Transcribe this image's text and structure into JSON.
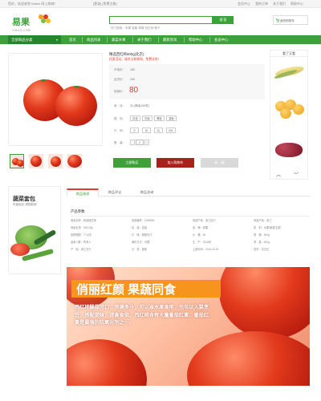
{
  "topbar": {
    "greeting": "您好，欢迎来到 Watch 网上商城！",
    "login_register": "[登录] [免费注册]",
    "links": [
      "会员中心",
      "我的订单",
      "关于我们",
      "帮助中心"
    ]
  },
  "header": {
    "logo_text": "易果",
    "logo_sub": "YIGUO.COM",
    "search_placeholder": "",
    "search_button": "搜 索",
    "hot_keywords": "热门搜索：苹果  香蕉  草莓  西红柿  橙子",
    "cart_label": "我的购物车"
  },
  "nav": {
    "all_categories": "全部商品分类",
    "items": [
      "首页",
      "商品列表",
      "蔬菜水果",
      "关于我们",
      "最新资讯",
      "帮助中心",
      "会员中心"
    ]
  },
  "product": {
    "title": "精选西红柿600g(北京)",
    "promo": "优惠活动，请关注易果网，免费试吃！",
    "market_price_label": "市场价：",
    "market_price": "150",
    "member_price_label": "会员价：",
    "member_price": "100",
    "sale_price_label": "促销价：",
    "sale_price": "80",
    "stock_label": "库　存：",
    "stock_value": "31 (剩余299件)",
    "color_label": "颜　色：",
    "colors": [
      "红色",
      "白色",
      "黑色",
      "蓝色"
    ],
    "size_label": "尺　码：",
    "sizes": [
      "S",
      "M",
      "XL",
      "XXL"
    ],
    "qty_label": "数　量：",
    "qty_value": "2",
    "buy_now": "立即购买",
    "add_to_cart": "加入购物车",
    "favorite": "收　藏"
  },
  "side": {
    "title": "看了又看"
  },
  "promo_card": {
    "title": "蔬菜套包",
    "subtitle": "时蔬组合 搭配新鲜"
  },
  "tabs": [
    "商品描述",
    "商品评论",
    "商品咨询"
  ],
  "params": {
    "title": "产品参数",
    "rows": [
      [
        "商品名称：精选西红柿",
        "商品编号：1049966",
        "商品产地：浙江嘉兴",
        "商品产地：浙江"
      ],
      [
        "商品毛重：500.00g",
        "包　装：盒装",
        "品　牌：易果",
        "类　别：水果/蔬菜/生鲜"
      ],
      [
        "保质期限：7~14天",
        "口　味：鲜甜可口",
        "价　格：80",
        "规　格：600g"
      ],
      [
        "适用人群：所有人",
        "储存方式：冷藏",
        "生　产：2016年",
        "重　量：600g"
      ],
      [
        "产　地：浙江嘉兴",
        "分　类：蔬菜",
        "上架时间：2016-03-18",
        "发货：次日达"
      ]
    ]
  },
  "banner": {
    "headline": "俏丽红颜 果蔬同食",
    "body": "西红柿酸甜可口，饱满多汁，可以当水果食用，也可以入菜烹饪，搭配提味，提高食欲。西红柿含有大量番茄红素，番茄红素是最强的抗氧化剂之一。"
  }
}
